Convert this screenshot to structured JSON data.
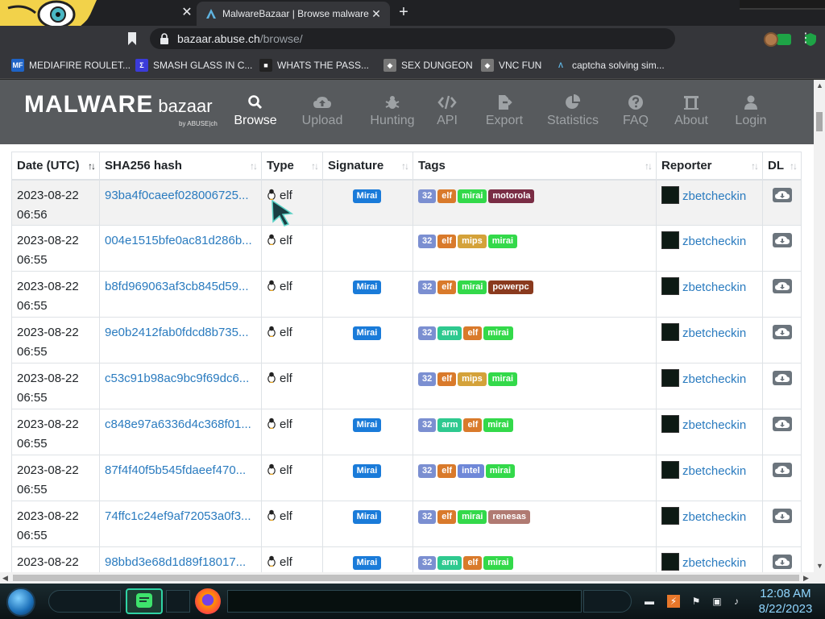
{
  "browser": {
    "prev_tab_close": "✕",
    "active_tab_title": "MalwareBazaar | Browse malware samples",
    "tab_close": "✕",
    "new_tab": "+",
    "url_host": "bazaar.abuse.ch",
    "url_path": "/browse/",
    "menu": "⋮"
  },
  "bookmarks": [
    {
      "label": "MEDIAFIRE ROULET...",
      "icon": "MF",
      "color": "#1e63c6"
    },
    {
      "label": "SMASH GLASS IN C...",
      "icon": "Σ",
      "color": "#3b3bd9"
    },
    {
      "label": "WHATS THE PASS...",
      "icon": "■",
      "color": "#222"
    },
    {
      "label": "SEX DUNGEON",
      "icon": "◆",
      "color": "#777"
    },
    {
      "label": "VNC FUN",
      "icon": "◆",
      "color": "#777"
    },
    {
      "label": "captcha solving sim...",
      "icon": "Λ",
      "color": "#35363a"
    }
  ],
  "site": {
    "brand_main": "MALWARE",
    "brand_sub": "bazaar",
    "brand_by": "by ABUSE|ch",
    "nav": [
      {
        "label": "Browse",
        "icon": "search-icon",
        "active": true
      },
      {
        "label": "Upload",
        "icon": "cloud-upload-icon",
        "active": false
      },
      {
        "label": "Hunting",
        "icon": "bug-icon",
        "active": false
      },
      {
        "label": "API",
        "icon": "code-icon",
        "active": false
      },
      {
        "label": "Export",
        "icon": "file-export-icon",
        "active": false
      },
      {
        "label": "Statistics",
        "icon": "pie-chart-icon",
        "active": false
      },
      {
        "label": "FAQ",
        "icon": "question-circle-icon",
        "active": false
      },
      {
        "label": "About",
        "icon": "building-icon",
        "active": false
      },
      {
        "label": "Login",
        "icon": "user-icon",
        "active": false
      }
    ]
  },
  "table": {
    "headers": [
      "Date (UTC)",
      "SHA256 hash",
      "Type",
      "Signature",
      "Tags",
      "Reporter",
      "DL"
    ],
    "rows": [
      {
        "date": "2023-08-22",
        "time": "06:56",
        "hash": "93ba4f0caeef028006725...",
        "type": "elf",
        "signature": "Mirai",
        "tags": [
          "32",
          "elf",
          "mirai",
          "motorola"
        ],
        "reporter": "zbetcheckin"
      },
      {
        "date": "2023-08-22",
        "time": "06:55",
        "hash": "004e1515bfe0ac81d286b...",
        "type": "elf",
        "signature": "",
        "tags": [
          "32",
          "elf",
          "mips",
          "mirai"
        ],
        "reporter": "zbetcheckin"
      },
      {
        "date": "2023-08-22",
        "time": "06:55",
        "hash": "b8fd969063af3cb845d59...",
        "type": "elf",
        "signature": "Mirai",
        "tags": [
          "32",
          "elf",
          "mirai",
          "powerpc"
        ],
        "reporter": "zbetcheckin"
      },
      {
        "date": "2023-08-22",
        "time": "06:55",
        "hash": "9e0b2412fab0fdcd8b735...",
        "type": "elf",
        "signature": "Mirai",
        "tags": [
          "32",
          "arm",
          "elf",
          "mirai"
        ],
        "reporter": "zbetcheckin"
      },
      {
        "date": "2023-08-22",
        "time": "06:55",
        "hash": "c53c91b98ac9bc9f69dc6...",
        "type": "elf",
        "signature": "",
        "tags": [
          "32",
          "elf",
          "mips",
          "mirai"
        ],
        "reporter": "zbetcheckin"
      },
      {
        "date": "2023-08-22",
        "time": "06:55",
        "hash": "c848e97a6336d4c368f01...",
        "type": "elf",
        "signature": "Mirai",
        "tags": [
          "32",
          "arm",
          "elf",
          "mirai"
        ],
        "reporter": "zbetcheckin"
      },
      {
        "date": "2023-08-22",
        "time": "06:55",
        "hash": "87f4f40f5b545fdaeef470...",
        "type": "elf",
        "signature": "Mirai",
        "tags": [
          "32",
          "elf",
          "intel",
          "mirai"
        ],
        "reporter": "zbetcheckin"
      },
      {
        "date": "2023-08-22",
        "time": "06:55",
        "hash": "74ffc1c24ef9af72053a0f3...",
        "type": "elf",
        "signature": "Mirai",
        "tags": [
          "32",
          "elf",
          "mirai",
          "renesas"
        ],
        "reporter": "zbetcheckin"
      },
      {
        "date": "2023-08-22",
        "time": "",
        "hash": "98bbd3e68d1d89f18017...",
        "type": "elf",
        "signature": "Mirai",
        "tags": [
          "32",
          "arm",
          "elf",
          "mirai"
        ],
        "reporter": "zbetcheckin"
      }
    ]
  },
  "tag_colors": {
    "32": "#7b8fd1",
    "elf": "#d97a2b",
    "mirai": "#33d94a",
    "motorola": "#7a2d45",
    "mips": "#d4a23a",
    "powerpc": "#8a3a1e",
    "arm": "#2ec98f",
    "intel": "#6f88d8",
    "renesas": "#b07a72",
    "signature": "#1a7bd9"
  },
  "taskbar": {
    "time": "12:08 AM",
    "date": "8/22/2023"
  }
}
